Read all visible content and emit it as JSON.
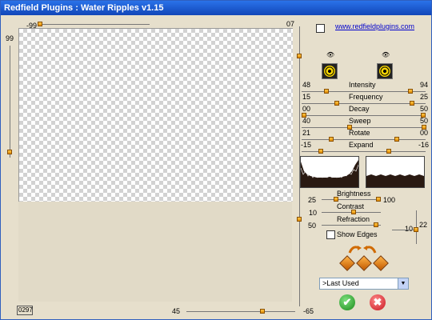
{
  "window": {
    "title": "Redfield Plugins : Water Ripples v1.15"
  },
  "canvas": {
    "top_left_value": "-99",
    "top_right_value": "07",
    "left_value": "99",
    "bottom_center_value": "45",
    "bottom_right_value": "-65",
    "zoom_box": "0297"
  },
  "link": {
    "text": "www.redfieldplugins.com"
  },
  "sliders": [
    {
      "label": "Intensity",
      "left": "48",
      "right": "94"
    },
    {
      "label": "Frequency",
      "left": "15",
      "right": "25"
    },
    {
      "label": "Decay",
      "left": "00",
      "right": "50"
    },
    {
      "label": "Sweep",
      "left": "40",
      "right": "50"
    },
    {
      "label": "Rotate",
      "left": "21",
      "right": "00"
    },
    {
      "label": "Expand",
      "left": "-15",
      "right": "-16"
    }
  ],
  "light": {
    "brightness": {
      "label": "Brightness",
      "left": "25",
      "right": "100"
    },
    "contrast": {
      "label": "Contrast",
      "value": "10"
    },
    "refraction": {
      "label": "Refraction",
      "value": "50"
    },
    "vertical_value": "22",
    "small_value": "10"
  },
  "show_edges": {
    "label": "Show Edges",
    "checked": false
  },
  "preset": {
    "selected": ">Last Used"
  },
  "icons": {
    "ok": "check-icon",
    "cancel": "cancel-icon",
    "speaker": "speaker-icon",
    "eye": "eye-icon"
  }
}
